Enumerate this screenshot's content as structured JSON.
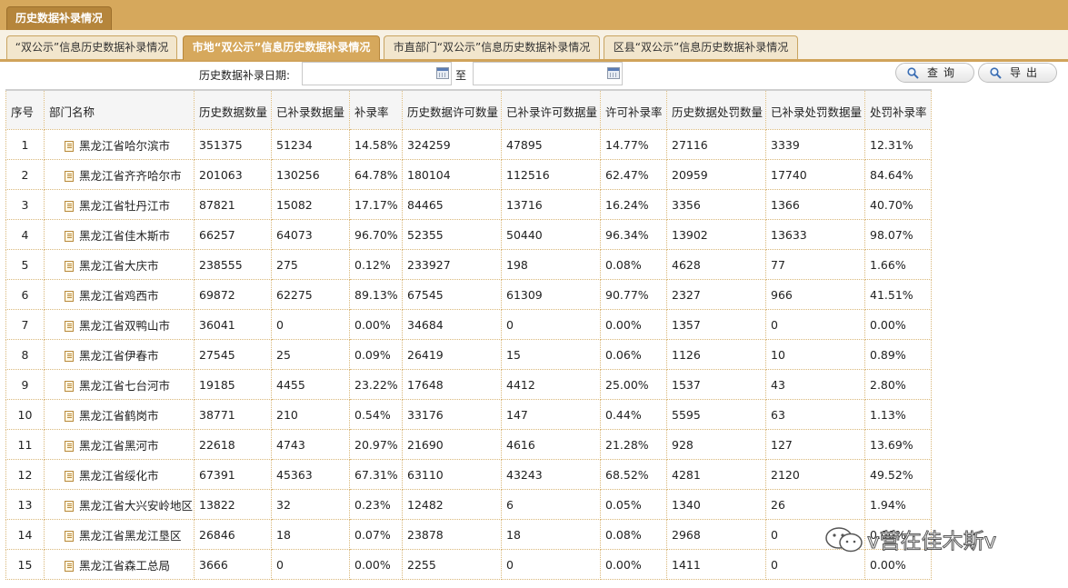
{
  "window": {
    "title_tab": "历史数据补录情况"
  },
  "tabs": [
    {
      "label": "“双公示”信息历史数据补录情况"
    },
    {
      "label": "市地“双公示”信息历史数据补录情况"
    },
    {
      "label": "市直部门“双公示”信息历史数据补录情况"
    },
    {
      "label": "区县“双公示”信息历史数据补录情况"
    }
  ],
  "active_tab": 1,
  "filter": {
    "date_label": "历史数据补录日期:",
    "to_label": "至",
    "start_value": "",
    "end_value": "",
    "query_label": "查询",
    "export_label": "导出"
  },
  "table": {
    "headers": [
      "序号",
      "部门名称",
      "历史数据数量",
      "已补录数据量",
      "补录率",
      "历史数据许可数量",
      "已补录许可数据量",
      "许可补录率",
      "历史数据处罚数量",
      "已补录处罚数据量",
      "处罚补录率"
    ],
    "rows": [
      [
        "1",
        "黑龙江省哈尔滨市",
        "351375",
        "51234",
        "14.58%",
        "324259",
        "47895",
        "14.77%",
        "27116",
        "3339",
        "12.31%"
      ],
      [
        "2",
        "黑龙江省齐齐哈尔市",
        "201063",
        "130256",
        "64.78%",
        "180104",
        "112516",
        "62.47%",
        "20959",
        "17740",
        "84.64%"
      ],
      [
        "3",
        "黑龙江省牡丹江市",
        "87821",
        "15082",
        "17.17%",
        "84465",
        "13716",
        "16.24%",
        "3356",
        "1366",
        "40.70%"
      ],
      [
        "4",
        "黑龙江省佳木斯市",
        "66257",
        "64073",
        "96.70%",
        "52355",
        "50440",
        "96.34%",
        "13902",
        "13633",
        "98.07%"
      ],
      [
        "5",
        "黑龙江省大庆市",
        "238555",
        "275",
        "0.12%",
        "233927",
        "198",
        "0.08%",
        "4628",
        "77",
        "1.66%"
      ],
      [
        "6",
        "黑龙江省鸡西市",
        "69872",
        "62275",
        "89.13%",
        "67545",
        "61309",
        "90.77%",
        "2327",
        "966",
        "41.51%"
      ],
      [
        "7",
        "黑龙江省双鸭山市",
        "36041",
        "0",
        "0.00%",
        "34684",
        "0",
        "0.00%",
        "1357",
        "0",
        "0.00%"
      ],
      [
        "8",
        "黑龙江省伊春市",
        "27545",
        "25",
        "0.09%",
        "26419",
        "15",
        "0.06%",
        "1126",
        "10",
        "0.89%"
      ],
      [
        "9",
        "黑龙江省七台河市",
        "19185",
        "4455",
        "23.22%",
        "17648",
        "4412",
        "25.00%",
        "1537",
        "43",
        "2.80%"
      ],
      [
        "10",
        "黑龙江省鹤岗市",
        "38771",
        "210",
        "0.54%",
        "33176",
        "147",
        "0.44%",
        "5595",
        "63",
        "1.13%"
      ],
      [
        "11",
        "黑龙江省黑河市",
        "22618",
        "4743",
        "20.97%",
        "21690",
        "4616",
        "21.28%",
        "928",
        "127",
        "13.69%"
      ],
      [
        "12",
        "黑龙江省绥化市",
        "67391",
        "45363",
        "67.31%",
        "63110",
        "43243",
        "68.52%",
        "4281",
        "2120",
        "49.52%"
      ],
      [
        "13",
        "黑龙江省大兴安岭地区",
        "13822",
        "32",
        "0.23%",
        "12482",
        "6",
        "0.05%",
        "1340",
        "26",
        "1.94%"
      ],
      [
        "14",
        "黑龙江省黑龙江垦区",
        "26846",
        "18",
        "0.07%",
        "23878",
        "18",
        "0.08%",
        "2968",
        "0",
        "0.00%"
      ],
      [
        "15",
        "黑龙江省森工总局",
        "3666",
        "0",
        "0.00%",
        "2255",
        "0",
        "0.00%",
        "1411",
        "0",
        "0.00%"
      ]
    ]
  },
  "watermark": {
    "text": "v营在佳木斯v"
  }
}
